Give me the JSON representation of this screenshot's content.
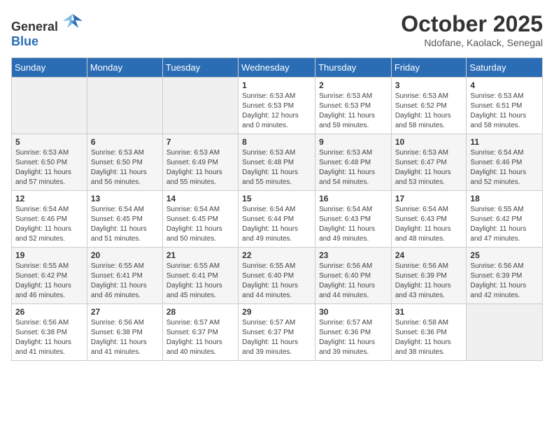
{
  "header": {
    "logo_general": "General",
    "logo_blue": "Blue",
    "month": "October 2025",
    "location": "Ndofane, Kaolack, Senegal"
  },
  "weekdays": [
    "Sunday",
    "Monday",
    "Tuesday",
    "Wednesday",
    "Thursday",
    "Friday",
    "Saturday"
  ],
  "weeks": [
    [
      {
        "day": "",
        "info": ""
      },
      {
        "day": "",
        "info": ""
      },
      {
        "day": "",
        "info": ""
      },
      {
        "day": "1",
        "info": "Sunrise: 6:53 AM\nSunset: 6:53 PM\nDaylight: 12 hours\nand 0 minutes."
      },
      {
        "day": "2",
        "info": "Sunrise: 6:53 AM\nSunset: 6:53 PM\nDaylight: 11 hours\nand 59 minutes."
      },
      {
        "day": "3",
        "info": "Sunrise: 6:53 AM\nSunset: 6:52 PM\nDaylight: 11 hours\nand 58 minutes."
      },
      {
        "day": "4",
        "info": "Sunrise: 6:53 AM\nSunset: 6:51 PM\nDaylight: 11 hours\nand 58 minutes."
      }
    ],
    [
      {
        "day": "5",
        "info": "Sunrise: 6:53 AM\nSunset: 6:50 PM\nDaylight: 11 hours\nand 57 minutes."
      },
      {
        "day": "6",
        "info": "Sunrise: 6:53 AM\nSunset: 6:50 PM\nDaylight: 11 hours\nand 56 minutes."
      },
      {
        "day": "7",
        "info": "Sunrise: 6:53 AM\nSunset: 6:49 PM\nDaylight: 11 hours\nand 55 minutes."
      },
      {
        "day": "8",
        "info": "Sunrise: 6:53 AM\nSunset: 6:48 PM\nDaylight: 11 hours\nand 55 minutes."
      },
      {
        "day": "9",
        "info": "Sunrise: 6:53 AM\nSunset: 6:48 PM\nDaylight: 11 hours\nand 54 minutes."
      },
      {
        "day": "10",
        "info": "Sunrise: 6:53 AM\nSunset: 6:47 PM\nDaylight: 11 hours\nand 53 minutes."
      },
      {
        "day": "11",
        "info": "Sunrise: 6:54 AM\nSunset: 6:46 PM\nDaylight: 11 hours\nand 52 minutes."
      }
    ],
    [
      {
        "day": "12",
        "info": "Sunrise: 6:54 AM\nSunset: 6:46 PM\nDaylight: 11 hours\nand 52 minutes."
      },
      {
        "day": "13",
        "info": "Sunrise: 6:54 AM\nSunset: 6:45 PM\nDaylight: 11 hours\nand 51 minutes."
      },
      {
        "day": "14",
        "info": "Sunrise: 6:54 AM\nSunset: 6:45 PM\nDaylight: 11 hours\nand 50 minutes."
      },
      {
        "day": "15",
        "info": "Sunrise: 6:54 AM\nSunset: 6:44 PM\nDaylight: 11 hours\nand 49 minutes."
      },
      {
        "day": "16",
        "info": "Sunrise: 6:54 AM\nSunset: 6:43 PM\nDaylight: 11 hours\nand 49 minutes."
      },
      {
        "day": "17",
        "info": "Sunrise: 6:54 AM\nSunset: 6:43 PM\nDaylight: 11 hours\nand 48 minutes."
      },
      {
        "day": "18",
        "info": "Sunrise: 6:55 AM\nSunset: 6:42 PM\nDaylight: 11 hours\nand 47 minutes."
      }
    ],
    [
      {
        "day": "19",
        "info": "Sunrise: 6:55 AM\nSunset: 6:42 PM\nDaylight: 11 hours\nand 46 minutes."
      },
      {
        "day": "20",
        "info": "Sunrise: 6:55 AM\nSunset: 6:41 PM\nDaylight: 11 hours\nand 46 minutes."
      },
      {
        "day": "21",
        "info": "Sunrise: 6:55 AM\nSunset: 6:41 PM\nDaylight: 11 hours\nand 45 minutes."
      },
      {
        "day": "22",
        "info": "Sunrise: 6:55 AM\nSunset: 6:40 PM\nDaylight: 11 hours\nand 44 minutes."
      },
      {
        "day": "23",
        "info": "Sunrise: 6:56 AM\nSunset: 6:40 PM\nDaylight: 11 hours\nand 44 minutes."
      },
      {
        "day": "24",
        "info": "Sunrise: 6:56 AM\nSunset: 6:39 PM\nDaylight: 11 hours\nand 43 minutes."
      },
      {
        "day": "25",
        "info": "Sunrise: 6:56 AM\nSunset: 6:39 PM\nDaylight: 11 hours\nand 42 minutes."
      }
    ],
    [
      {
        "day": "26",
        "info": "Sunrise: 6:56 AM\nSunset: 6:38 PM\nDaylight: 11 hours\nand 41 minutes."
      },
      {
        "day": "27",
        "info": "Sunrise: 6:56 AM\nSunset: 6:38 PM\nDaylight: 11 hours\nand 41 minutes."
      },
      {
        "day": "28",
        "info": "Sunrise: 6:57 AM\nSunset: 6:37 PM\nDaylight: 11 hours\nand 40 minutes."
      },
      {
        "day": "29",
        "info": "Sunrise: 6:57 AM\nSunset: 6:37 PM\nDaylight: 11 hours\nand 39 minutes."
      },
      {
        "day": "30",
        "info": "Sunrise: 6:57 AM\nSunset: 6:36 PM\nDaylight: 11 hours\nand 39 minutes."
      },
      {
        "day": "31",
        "info": "Sunrise: 6:58 AM\nSunset: 6:36 PM\nDaylight: 11 hours\nand 38 minutes."
      },
      {
        "day": "",
        "info": ""
      }
    ]
  ]
}
